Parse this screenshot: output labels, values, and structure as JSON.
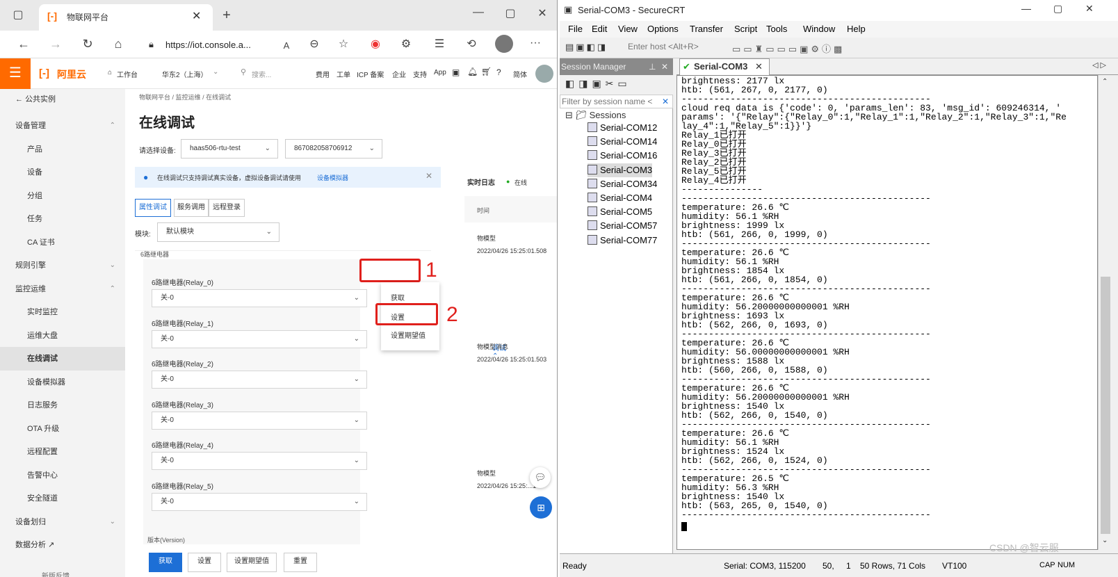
{
  "browser": {
    "tab_title": "物联网平台",
    "url": "https://iot.console.a...",
    "read_aloud": "A",
    "more": "···"
  },
  "aliyun": {
    "logo": "阿里云",
    "workbench": "工作台",
    "region": "华东2（上海）",
    "search_placeholder": "搜索...",
    "nav": [
      "费用",
      "工单",
      "ICP 备案",
      "企业",
      "支持",
      "App"
    ],
    "lang": "简体"
  },
  "sidebar": {
    "back": "公共实例",
    "items": [
      {
        "label": "设备管理",
        "type": "grp",
        "chev": "⌃"
      },
      {
        "label": "产品",
        "type": "sub"
      },
      {
        "label": "设备",
        "type": "sub"
      },
      {
        "label": "分组",
        "type": "sub"
      },
      {
        "label": "任务",
        "type": "sub"
      },
      {
        "label": "CA 证书",
        "type": "sub"
      },
      {
        "label": "规则引擎",
        "type": "grp",
        "chev": "⌄"
      },
      {
        "label": "监控运维",
        "type": "grp",
        "chev": "⌃"
      },
      {
        "label": "实时监控",
        "type": "sub"
      },
      {
        "label": "运维大盘",
        "type": "sub"
      },
      {
        "label": "在线调试",
        "type": "sub",
        "active": true
      },
      {
        "label": "设备模拟器",
        "type": "sub"
      },
      {
        "label": "日志服务",
        "type": "sub"
      },
      {
        "label": "OTA 升级",
        "type": "sub"
      },
      {
        "label": "远程配置",
        "type": "sub"
      },
      {
        "label": "告警中心",
        "type": "sub"
      },
      {
        "label": "安全隧道",
        "type": "sub"
      },
      {
        "label": "设备划归",
        "type": "grp",
        "chev": "⌄"
      },
      {
        "label": "数据分析 ↗",
        "type": "grp"
      }
    ],
    "feedback": "新版反馈"
  },
  "main": {
    "breadcrumb": [
      "物联网平台",
      "监控运维",
      "在线调试"
    ],
    "title": "在线调试",
    "device_label": "请选择设备:",
    "product": "haas506-rtu-test",
    "device": "867082058706912",
    "notice": "在线调试只支持调试真实设备，虚拟设备调试请使用",
    "notice_link": "设备模拟器",
    "tabs": [
      "属性调试",
      "服务调用",
      "远程登录"
    ],
    "module_label": "模块:",
    "module": "默认模块",
    "group_title": "6路继电器",
    "debug_link": "调试",
    "dropdown": [
      "获取",
      "设置",
      "设置期望值"
    ],
    "relays": [
      {
        "label": "6路继电器(Relay_0)",
        "value": "关-0"
      },
      {
        "label": "6路继电器(Relay_1)",
        "value": "关-0"
      },
      {
        "label": "6路继电器(Relay_2)",
        "value": "关-0"
      },
      {
        "label": "6路继电器(Relay_3)",
        "value": "关-0"
      },
      {
        "label": "6路继电器(Relay_4)",
        "value": "关-0"
      },
      {
        "label": "6路继电器(Relay_5)",
        "value": "关-0"
      }
    ],
    "version_label": "版本(Version)",
    "buttons": [
      "获取",
      "设置",
      "设置期望值",
      "重置"
    ],
    "annotations": [
      "1",
      "2"
    ]
  },
  "log": {
    "title": "实时日志",
    "status": "在线",
    "time_header": "时间",
    "entries": [
      {
        "type": "物模型",
        "time": "2022/04/26 15:25:01.508"
      },
      {
        "type": "物模型消息",
        "time": "2022/04/26 15:25:01.503"
      },
      {
        "type": "物模型",
        "time": "2022/04/26 15:25:...1"
      }
    ]
  },
  "crt": {
    "title": "Serial-COM3 - SecureCRT",
    "menu": [
      "File",
      "Edit",
      "View",
      "Options",
      "Transfer",
      "Script",
      "Tools",
      "Window",
      "Help"
    ],
    "host_placeholder": "Enter host <Alt+R>",
    "session_manager": "Session Manager",
    "filter_placeholder": "Filter by session name <",
    "sessions_root": "Sessions",
    "sessions": [
      "Serial-COM12",
      "Serial-COM14",
      "Serial-COM16",
      "Serial-COM3",
      "Serial-COM34",
      "Serial-COM4",
      "Serial-COM5",
      "Serial-COM57",
      "Serial-COM77"
    ],
    "tab": "Serial-COM3",
    "terminal_lines": [
      "brightness: 2177 lx",
      "htb: (561, 267, 0, 2177, 0)",
      "----------------------------------------------",
      "cloud req data is {'code': 0, 'params_len': 83, 'msg_id': 609246314, '",
      "params': '{\"Relay\":{\"Relay_0\":1,\"Relay_1\":1,\"Relay_2\":1,\"Relay_3\":1,\"Re",
      "lay_4\":1,\"Relay_5\":1}}'}",
      "Relay_1已打开",
      "Relay_0已打开",
      "Relay_3已打开",
      "Relay_2已打开",
      "Relay_5已打开",
      "Relay_4已打开",
      "---------------",
      "----------------------------------------------",
      "temperature: 26.6 ℃",
      "humidity: 56.1 %RH",
      "brightness: 1999 lx",
      "htb: (561, 266, 0, 1999, 0)",
      "----------------------------------------------",
      "temperature: 26.6 ℃",
      "humidity: 56.1 %RH",
      "brightness: 1854 lx",
      "htb: (561, 266, 0, 1854, 0)",
      "----------------------------------------------",
      "temperature: 26.6 ℃",
      "humidity: 56.20000000000001 %RH",
      "brightness: 1693 lx",
      "htb: (562, 266, 0, 1693, 0)",
      "----------------------------------------------",
      "temperature: 26.6 ℃",
      "humidity: 56.00000000000001 %RH",
      "brightness: 1588 lx",
      "htb: (560, 266, 0, 1588, 0)",
      "----------------------------------------------",
      "temperature: 26.6 ℃",
      "humidity: 56.20000000000001 %RH",
      "brightness: 1540 lx",
      "htb: (562, 266, 0, 1540, 0)",
      "----------------------------------------------",
      "temperature: 26.6 ℃",
      "humidity: 56.1 %RH",
      "brightness: 1524 lx",
      "htb: (562, 266, 0, 1524, 0)",
      "----------------------------------------------",
      "temperature: 26.5 ℃",
      "humidity: 56.3 %RH",
      "brightness: 1540 lx",
      "htb: (563, 265, 0, 1540, 0)",
      "----------------------------------------------"
    ],
    "status": {
      "ready": "Ready",
      "port": "Serial: COM3, 115200",
      "row": "50,",
      "col": "1",
      "size": "50 Rows, 71 Cols",
      "term": "VT100",
      "caps": "CAP",
      "num": "NUM"
    },
    "watermark": "CSDN @智云服"
  }
}
